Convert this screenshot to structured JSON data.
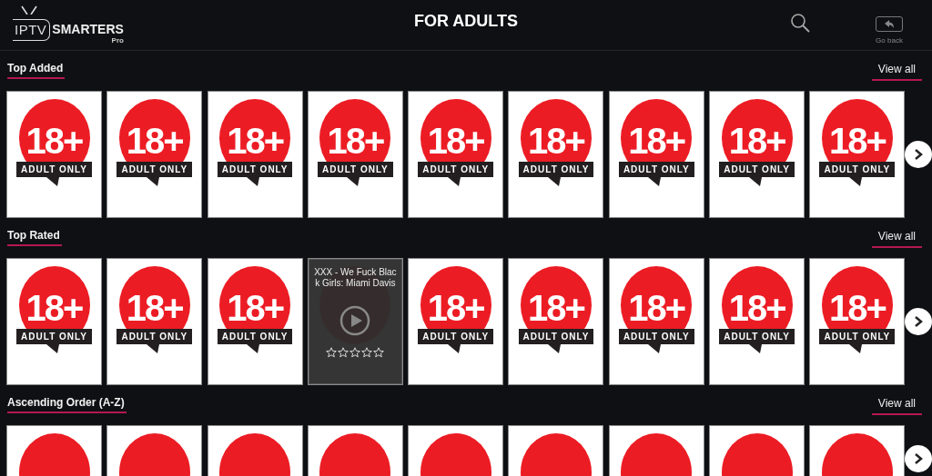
{
  "header": {
    "logo": {
      "word1": "IPTV",
      "word2": "SMARTERS",
      "sub": "Pro"
    },
    "title": "FOR ADULTS",
    "back_label": "Go back"
  },
  "sections": [
    {
      "title": "Top Added",
      "view_all": "View all",
      "items": [
        {
          "kind": "poster",
          "badge": "18+",
          "label": "ADULT ONLY",
          "focused": false
        },
        {
          "kind": "poster",
          "badge": "18+",
          "label": "ADULT ONLY",
          "focused": false
        },
        {
          "kind": "poster",
          "badge": "18+",
          "label": "ADULT ONLY",
          "focused": false
        },
        {
          "kind": "poster",
          "badge": "18+",
          "label": "ADULT ONLY",
          "focused": false
        },
        {
          "kind": "poster",
          "badge": "18+",
          "label": "ADULT ONLY",
          "focused": false
        },
        {
          "kind": "poster",
          "badge": "18+",
          "label": "ADULT ONLY",
          "focused": false
        },
        {
          "kind": "poster",
          "badge": "18+",
          "label": "ADULT ONLY",
          "focused": false
        },
        {
          "kind": "poster",
          "badge": "18+",
          "label": "ADULT ONLY",
          "focused": false
        },
        {
          "kind": "poster",
          "badge": "18+",
          "label": "ADULT ONLY",
          "focused": false
        }
      ]
    },
    {
      "title": "Top Rated",
      "view_all": "View all",
      "items": [
        {
          "kind": "poster",
          "badge": "18+",
          "label": "ADULT ONLY",
          "focused": false
        },
        {
          "kind": "poster",
          "badge": "18+",
          "label": "ADULT ONLY",
          "focused": false
        },
        {
          "kind": "poster",
          "badge": "18+",
          "label": "ADULT ONLY",
          "focused": false
        },
        {
          "kind": "poster",
          "focused": true,
          "title": "XXX - We Fuck Black Girls: Miami Davis",
          "stars": 0
        },
        {
          "kind": "poster",
          "badge": "18+",
          "label": "ADULT ONLY",
          "focused": false
        },
        {
          "kind": "poster",
          "badge": "18+",
          "label": "ADULT ONLY",
          "focused": false
        },
        {
          "kind": "poster",
          "badge": "18+",
          "label": "ADULT ONLY",
          "focused": false
        },
        {
          "kind": "poster",
          "badge": "18+",
          "label": "ADULT ONLY",
          "focused": false
        },
        {
          "kind": "poster",
          "badge": "18+",
          "label": "ADULT ONLY",
          "focused": false
        }
      ]
    },
    {
      "title": "Ascending Order (A-Z)",
      "view_all": "View all",
      "items": [
        {
          "kind": "poster",
          "focused": false
        },
        {
          "kind": "poster",
          "focused": false
        },
        {
          "kind": "poster",
          "focused": false
        },
        {
          "kind": "poster",
          "focused": false
        },
        {
          "kind": "poster",
          "focused": false
        },
        {
          "kind": "poster",
          "focused": false
        },
        {
          "kind": "poster",
          "focused": false
        },
        {
          "kind": "poster",
          "focused": false
        },
        {
          "kind": "poster",
          "focused": false
        }
      ]
    }
  ]
}
